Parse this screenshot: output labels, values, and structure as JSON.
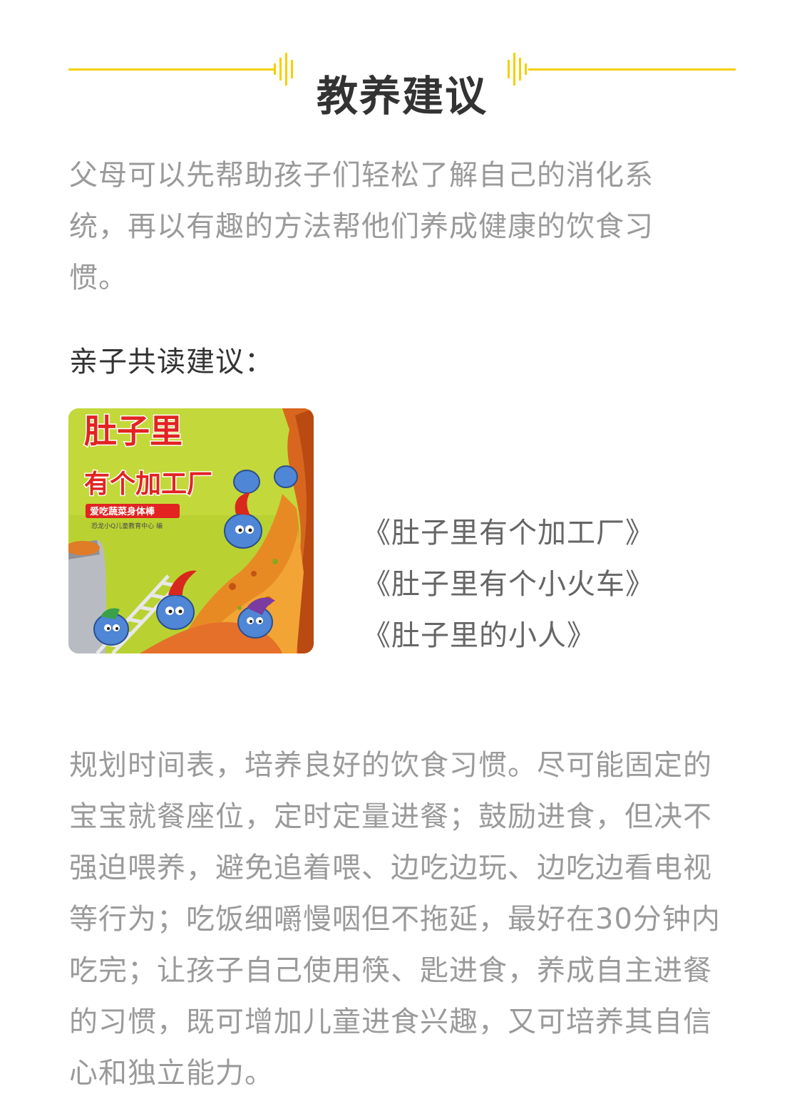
{
  "section": {
    "title": "教养建议",
    "accent_color": "#f5cf00"
  },
  "intro_text": "父母可以先帮助孩子们轻松了解自己的消化系统，再以有趣的方法帮他们养成健康的饮食习惯。",
  "reading_heading": "亲子共读建议：",
  "book_cover": {
    "title_line1": "肚子里",
    "title_line2": "有个加工厂",
    "series_label": "爱吃蔬菜身体棒",
    "publisher": "恐龙小Q儿童教育中心 编"
  },
  "books": [
    "《肚子里有个加工厂》",
    "《肚子里有个小火车》",
    "《肚子里的小人》"
  ],
  "advice_text": "规划时间表，培养良好的饮食习惯。尽可能固定的宝宝就餐座位，定时定量进餐；鼓励进食，但决不强迫喂养，避免追着喂、边吃边玩、边吃边看电视等行为；吃饭细嚼慢咽但不拖延，最好在30分钟内吃完；让孩子自己使用筷、匙进食，养成自主进餐的习惯，既可增加儿童进食兴趣，又可培养其自信心和独立能力。"
}
